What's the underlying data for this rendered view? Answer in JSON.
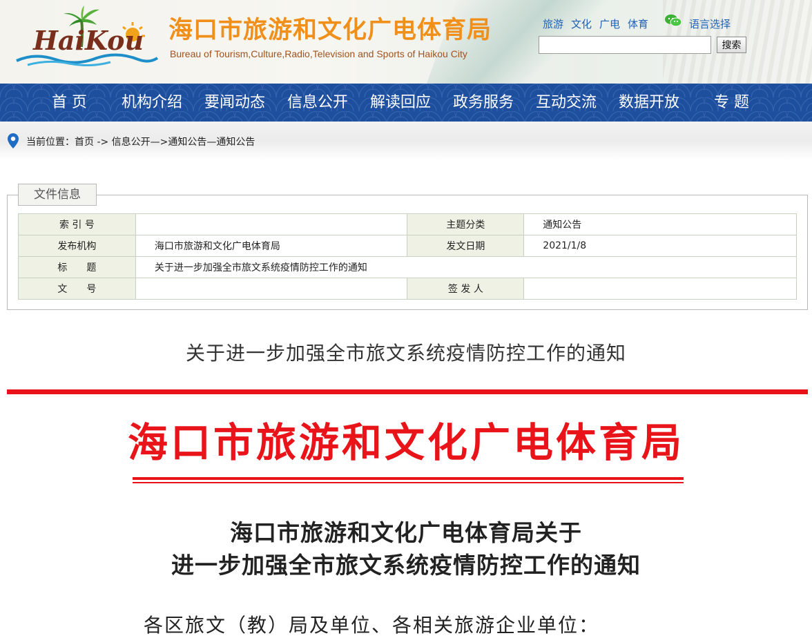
{
  "header": {
    "logo_text": "HaiKou",
    "site_title_cn": "海口市旅游和文化广电体育局",
    "site_title_en": "Bureau of Tourism,Culture,Radio,Television and Sports of Haikou City",
    "top_links": [
      "旅游",
      "文化",
      "广电",
      "体育"
    ],
    "language_label": "语言选择",
    "search": {
      "value": "",
      "button_label": "搜索"
    }
  },
  "nav": {
    "items": [
      "首 页",
      "机构介绍",
      "要闻动态",
      "信息公开",
      "解读回应",
      "政务服务",
      "互动交流",
      "数据开放",
      "专 题"
    ]
  },
  "breadcrumb": {
    "text": "当前位置：首页 -> 信息公开—>通知公告—通知公告"
  },
  "file_info": {
    "legend": "文件信息",
    "rows": [
      {
        "label1": "索 引 号",
        "value1": "",
        "label2": "主题分类",
        "value2": "通知公告"
      },
      {
        "label1": "发布机构",
        "value1": "海口市旅游和文化广电体育局",
        "label2": "发文日期",
        "value2": "2021/1/8"
      },
      {
        "label1": "标　　题",
        "value1": "关于进一步加强全市旅文系统疫情防控工作的通知"
      },
      {
        "label1": "文　　号",
        "value1": "",
        "label2": "签 发 人",
        "value2": ""
      }
    ]
  },
  "article": {
    "title": "关于进一步加强全市旅文系统疫情防控工作的通知",
    "doc_header": "海口市旅游和文化广电体育局",
    "doc_title_line1": "海口市旅游和文化广电体育局关于",
    "doc_title_line2": "进一步加强全市旅文系统疫情防控工作的通知",
    "body_start": "各区旅文（教）局及单位、各相关旅游企业单位："
  },
  "colors": {
    "nav_bg": "#1e4f9f",
    "title_orange": "#f0901a",
    "link_blue": "#2162b5",
    "doc_red": "#e8141a",
    "label_bg": "#eef1e4"
  }
}
